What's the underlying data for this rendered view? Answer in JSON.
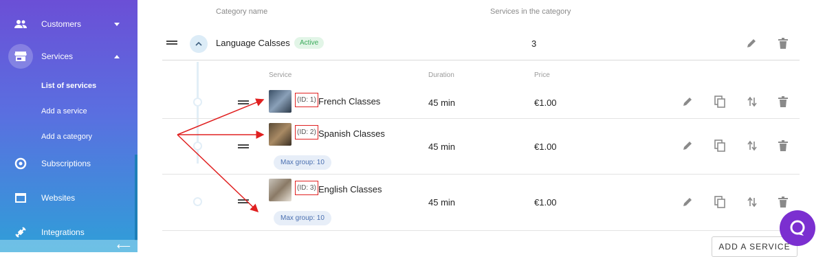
{
  "sidebar": {
    "items": [
      {
        "label": "Customers",
        "icon": "people-icon"
      },
      {
        "label": "Services",
        "icon": "store-icon"
      },
      {
        "label": "Subscriptions",
        "icon": "subscriptions-icon"
      },
      {
        "label": "Websites",
        "icon": "browser-icon"
      },
      {
        "label": "Integrations",
        "icon": "plug-icon"
      }
    ],
    "sub_items": [
      "List of services",
      "Add a service",
      "Add a category"
    ],
    "collapse_icon": "arrow-left-icon"
  },
  "table": {
    "col_category_name": "Category name",
    "col_services_count": "Services in the category"
  },
  "category": {
    "name": "Language Calsses",
    "status": "Active",
    "count": "3"
  },
  "services_header": {
    "service": "Service",
    "duration": "Duration",
    "price": "Price"
  },
  "services": [
    {
      "id": "(ID: 1)",
      "name": "French Classes",
      "duration": "45 min",
      "price": "€1.00",
      "max_group": ""
    },
    {
      "id": "(ID: 2)",
      "name": "Spanish Classes",
      "duration": "45 min",
      "price": "€1.00",
      "max_group": "Max group: 10"
    },
    {
      "id": "(ID: 3)",
      "name": "English Classes",
      "duration": "45 min",
      "price": "€1.00",
      "max_group": "Max group: 10"
    }
  ],
  "add_service_label": "ADD A SERVICE",
  "colors": {
    "accent": "#7b2fd0",
    "active_badge": "#3aaa5a",
    "annotation": "#e02020"
  }
}
